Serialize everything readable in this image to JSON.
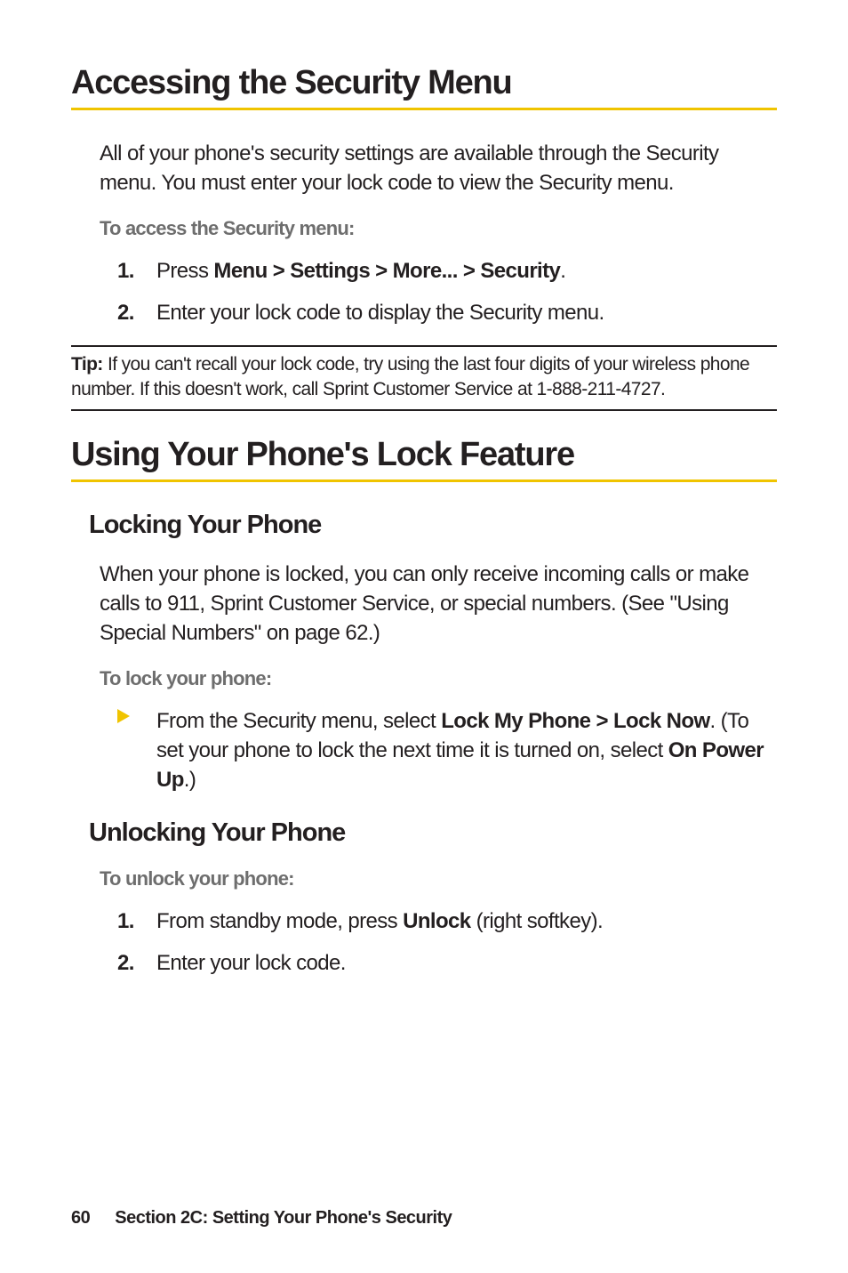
{
  "heading1": "Accessing the Security Menu",
  "intro_para": "All of your phone's security settings are available through the Security menu. You must enter your lock code to view the Security menu.",
  "access_label": "To access the Security menu:",
  "access_steps": {
    "s1_pre": "Press ",
    "s1_bold": "Menu > Settings > More... > Security",
    "s1_post": ".",
    "s2": "Enter your lock code to display the Security menu."
  },
  "tip": {
    "label": "Tip: ",
    "text": "If you can't recall your lock code, try using the last four digits of your wireless phone number. If this doesn't work, call Sprint Customer Service at 1-888-211-4727."
  },
  "heading2": "Using Your Phone's Lock Feature",
  "sub1": "Locking Your Phone",
  "sub1_para": "When your phone is locked, you can only receive incoming calls or make calls to 911, Sprint Customer Service, or special numbers. (See \"Using Special Numbers\" on page 62.)",
  "lock_label": "To lock your phone:",
  "lock_bullet": {
    "pre": "From the Security menu, select ",
    "bold1": "Lock My Phone > Lock Now",
    "mid": ". (To set your phone to lock the next time it is turned on, select ",
    "bold2": "On Power Up",
    "post": ".)"
  },
  "sub2": "Unlocking Your Phone",
  "unlock_label": "To unlock your phone:",
  "unlock_steps": {
    "s1_pre": "From standby mode, press ",
    "s1_bold": "Unlock",
    "s1_post": " (right softkey).",
    "s2": "Enter your lock code."
  },
  "footer": {
    "page": "60",
    "section": "Section 2C: Setting Your Phone's Security"
  },
  "markers": {
    "one": "1.",
    "two": "2."
  },
  "colors": {
    "accent": "#f0c400",
    "triangle": "#f0c400"
  }
}
